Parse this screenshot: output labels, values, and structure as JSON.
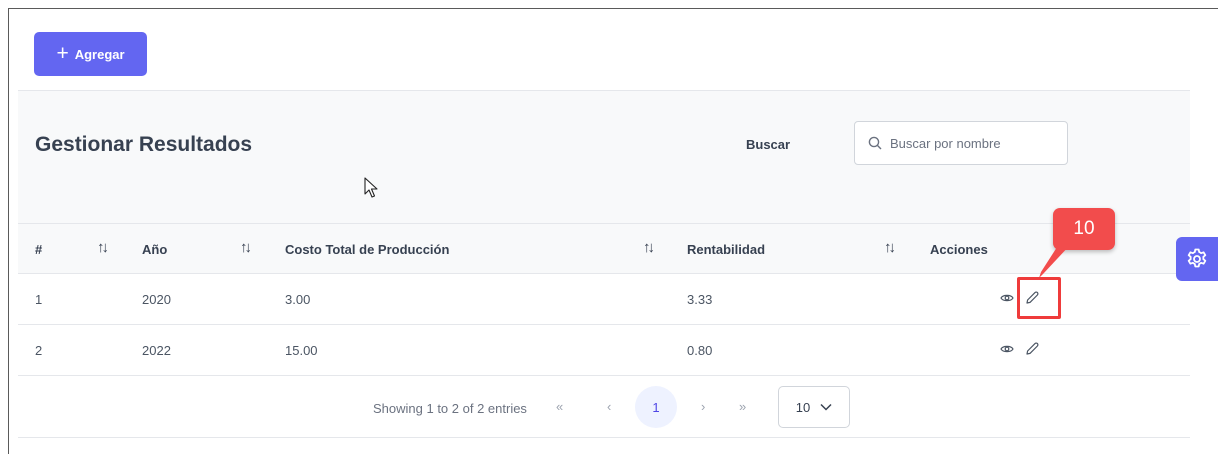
{
  "toolbar": {
    "add_label": "Agregar"
  },
  "header": {
    "title": "Gestionar Resultados",
    "search_label": "Buscar",
    "search_placeholder": "Buscar por nombre"
  },
  "table": {
    "columns": [
      "#",
      "Año",
      "Costo Total de Producción",
      "Rentabilidad",
      "Acciones"
    ],
    "rows": [
      {
        "num": "1",
        "year": "2020",
        "cost": "3.00",
        "profit": "3.33"
      },
      {
        "num": "2",
        "year": "2022",
        "cost": "15.00",
        "profit": "0.80"
      }
    ]
  },
  "pagination": {
    "info": "Showing 1 to 2 of 2 entries",
    "first": "«",
    "prev": "‹",
    "current_page": "1",
    "next": "›",
    "last": "»",
    "per_page": "10"
  },
  "annotation": {
    "step": "10"
  },
  "colors": {
    "accent": "#6366f1",
    "callout": "#f24c4c"
  }
}
